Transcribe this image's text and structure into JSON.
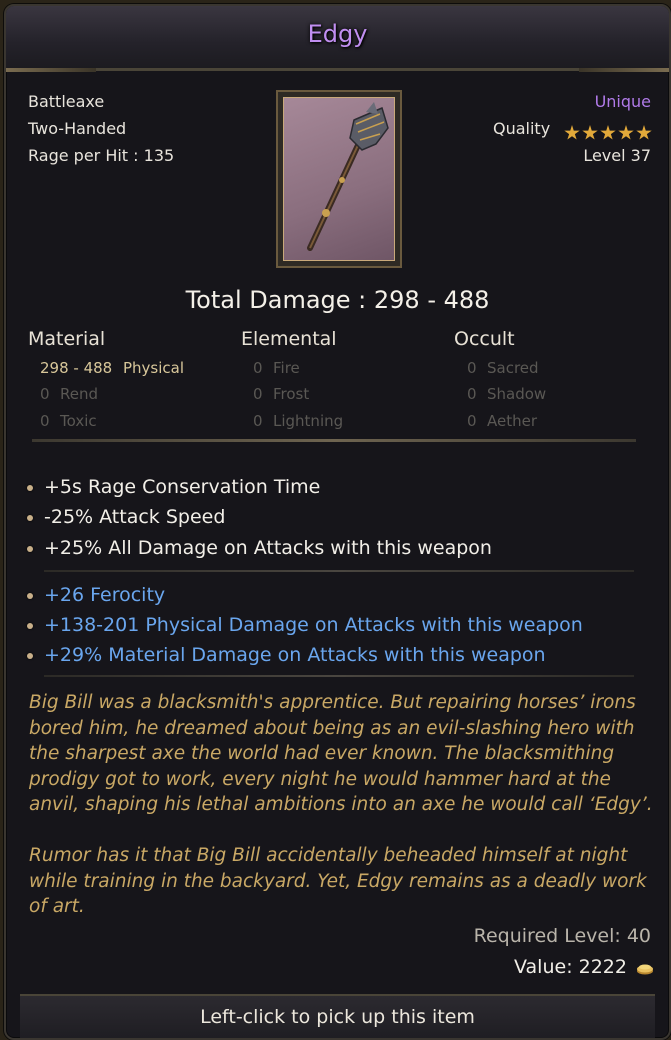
{
  "item": {
    "name": "Edgy",
    "weapon_type": "Battleaxe",
    "handedness": "Two-Handed",
    "rage_per_hit": "Rage per Hit : 135",
    "rarity": "Unique",
    "quality_label": "Quality",
    "quality_stars": 5,
    "level": "Level 37",
    "total_damage": "Total Damage : 298 - 488"
  },
  "damage": {
    "material": {
      "header": "Material",
      "rows": [
        {
          "value": "298 - 488",
          "type": "Physical"
        },
        {
          "value": "0",
          "type": "Rend"
        },
        {
          "value": "0",
          "type": "Toxic"
        }
      ]
    },
    "elemental": {
      "header": "Elemental",
      "rows": [
        {
          "value": "0",
          "type": "Fire"
        },
        {
          "value": "0",
          "type": "Frost"
        },
        {
          "value": "0",
          "type": "Lightning"
        }
      ]
    },
    "occult": {
      "header": "Occult",
      "rows": [
        {
          "value": "0",
          "type": "Sacred"
        },
        {
          "value": "0",
          "type": "Shadow"
        },
        {
          "value": "0",
          "type": "Aether"
        }
      ]
    }
  },
  "base_affixes": [
    "+5s Rage Conservation Time",
    "-25% Attack Speed",
    "+25% All Damage on Attacks with this weapon"
  ],
  "magic_affixes": [
    "+26 Ferocity",
    "+138-201 Physical Damage on Attacks with this weapon",
    "+29% Material Damage on Attacks with this weapon"
  ],
  "lore": [
    "Big Bill was a blacksmith's apprentice. But repairing horses’ irons bored him, he dreamed about being as an evil-slashing hero with the sharpest axe the world had ever known. The blacksmithing prodigy got to work, every night he would hammer hard at the anvil, shaping his lethal ambitions into an axe he would call ‘Edgy’.",
    "Rumor has it that Big Bill accidentally beheaded himself at night while training in the backyard. Yet, Edgy remains as a deadly work of art."
  ],
  "requirements": {
    "required_level": "Required Level: 40",
    "value": "Value: 2222"
  },
  "footer": {
    "hint": "Left-click to pick up this item"
  },
  "colors": {
    "unique": "#b07ae8",
    "magic_affix": "#6aa6ee",
    "lore": "#c9a865"
  }
}
